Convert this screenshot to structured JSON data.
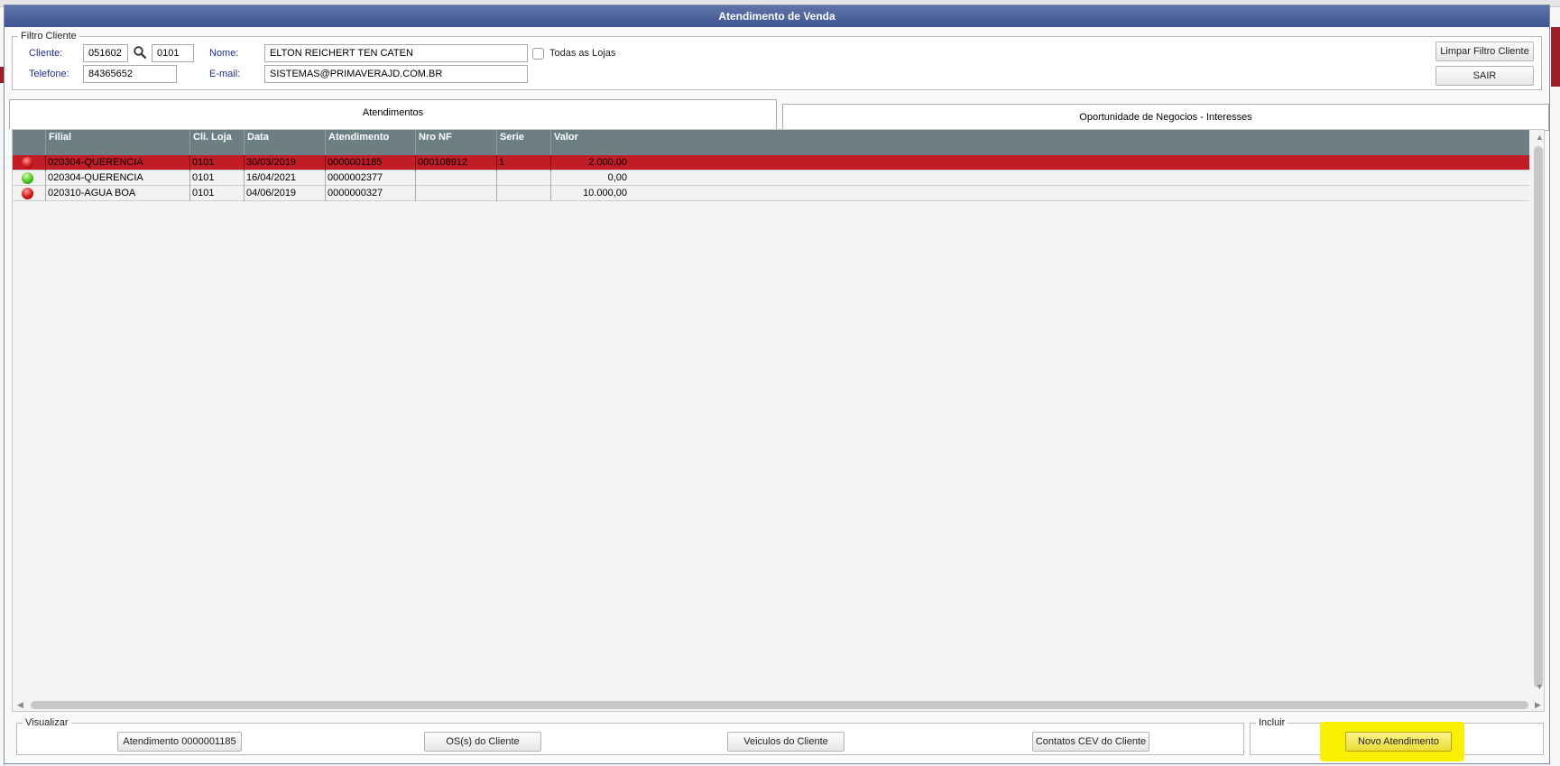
{
  "window": {
    "title": "Atendimento de Venda"
  },
  "filtro": {
    "legend": "Filtro Cliente",
    "cliente_label": "Cliente:",
    "cliente_codigo": "051602",
    "cliente_loja": "0101",
    "nome_label": "Nome:",
    "nome_value": "ELTON REICHERT TEN CATEN",
    "todas_lojas_label": "Todas as Lojas",
    "todas_lojas_checked": false,
    "telefone_label": "Telefone:",
    "telefone_value": "84365652",
    "email_label": "E-mail:",
    "email_value": "SISTEMAS@PRIMAVERAJD.COM.BR",
    "limpar_label": "Limpar Filtro Cliente",
    "sair_label": "SAIR"
  },
  "tabs": [
    {
      "label": "Atendimentos",
      "active": true
    },
    {
      "label": "Oportunidade de Negocios - Interesses",
      "active": false
    }
  ],
  "grid": {
    "columns": [
      "Filial",
      "Cli. Loja",
      "Data",
      "Atendimento",
      "Nro NF",
      "Serie",
      "Valor"
    ],
    "rows": [
      {
        "status": "red",
        "filial": "020304-QUERENCIA",
        "cli_loja": "0101",
        "data": "30/03/2019",
        "atendimento": "0000001185",
        "nro_nf": "000108912",
        "serie": "1",
        "valor": "2.000,00",
        "selected": true
      },
      {
        "status": "green",
        "filial": "020304-QUERENCIA",
        "cli_loja": "0101",
        "data": "16/04/2021",
        "atendimento": "0000002377",
        "nro_nf": "",
        "serie": "",
        "valor": "0,00",
        "selected": false
      },
      {
        "status": "red",
        "filial": "020310-AGUA BOA",
        "cli_loja": "0101",
        "data": "04/06/2019",
        "atendimento": "0000000327",
        "nro_nf": "",
        "serie": "",
        "valor": "10.000,00",
        "selected": false
      }
    ]
  },
  "visualizar": {
    "legend": "Visualizar",
    "buttons": [
      "Atendimento 0000001185",
      "OS(s) do Cliente",
      "Veiculos do Cliente",
      "Contatos CEV do Cliente"
    ]
  },
  "incluir": {
    "legend": "Incluir",
    "novo_label": "Novo Atendimento"
  },
  "colors": {
    "title_bar": "#4a5f99",
    "grid_header": "#6e7f84",
    "selected_row": "#c21c27",
    "highlight": "#f7f000"
  }
}
